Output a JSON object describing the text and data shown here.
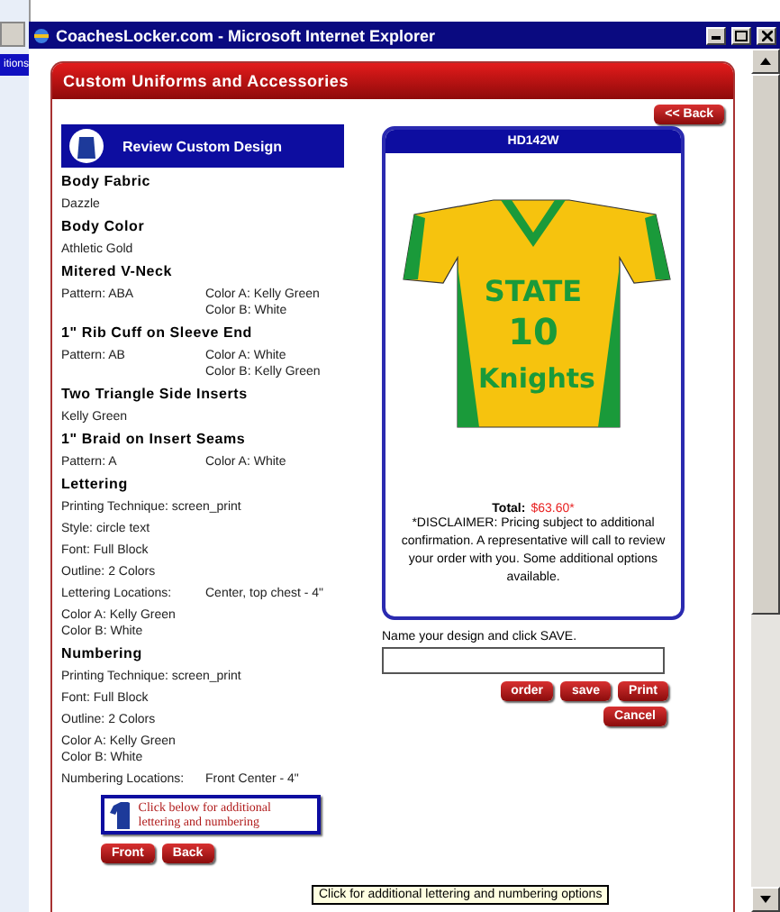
{
  "background": {
    "window_text": "itions"
  },
  "window": {
    "title": "CoachesLocker.com - Microsoft Internet Explorer"
  },
  "panel": {
    "title": "Custom Uniforms and Accessories",
    "back_button": "<< Back"
  },
  "review": {
    "title": "Review Custom Design",
    "sections": [
      {
        "heading": "Body Fabric",
        "lines": [
          {
            "kind": "text",
            "text": "Dazzle"
          }
        ]
      },
      {
        "heading": "Body Color",
        "lines": [
          {
            "kind": "text",
            "text": "Athletic Gold"
          }
        ]
      },
      {
        "heading": "Mitered V-Neck",
        "lines": [
          {
            "kind": "pair",
            "text": "Pattern: ABA",
            "values": [
              "Color A: Kelly Green",
              "Color B: White"
            ]
          }
        ]
      },
      {
        "heading": "1\" Rib Cuff on Sleeve End",
        "lines": [
          {
            "kind": "pair",
            "text": "Pattern: AB",
            "values": [
              "Color A: White",
              "Color B: Kelly Green"
            ]
          }
        ]
      },
      {
        "heading": "Two Triangle Side Inserts",
        "lines": [
          {
            "kind": "text",
            "text": "Kelly Green"
          }
        ]
      },
      {
        "heading": "1\" Braid on Insert Seams",
        "lines": [
          {
            "kind": "pair",
            "text": "Pattern: A",
            "values": [
              "Color A: White"
            ]
          }
        ]
      },
      {
        "heading": "Lettering",
        "lines": [
          {
            "kind": "text",
            "text": "Printing Technique: screen_print"
          },
          {
            "kind": "text",
            "text": "Style: circle text"
          },
          {
            "kind": "text",
            "text": "Font: Full Block"
          },
          {
            "kind": "text",
            "text": "Outline: 2 Colors"
          },
          {
            "kind": "pair",
            "text": "Lettering Locations:",
            "values": [
              "Center, top chest - 4\""
            ]
          },
          {
            "kind": "stack",
            "values": [
              "Color A: Kelly Green",
              "Color B: White"
            ]
          }
        ]
      },
      {
        "heading": "Numbering",
        "lines": [
          {
            "kind": "text",
            "text": "Printing Technique: screen_print"
          },
          {
            "kind": "text",
            "text": "Font: Full Block"
          },
          {
            "kind": "text",
            "text": "Outline: 2 Colors"
          },
          {
            "kind": "stack",
            "values": [
              "Color A: Kelly Green",
              "Color B: White"
            ]
          },
          {
            "kind": "pair",
            "text": "Numbering Locations:",
            "values": [
              "Front Center - 4\""
            ]
          }
        ]
      }
    ]
  },
  "promo": {
    "text": "Click below for additional lettering and numbering"
  },
  "view_buttons": [
    "Front",
    "Back"
  ],
  "product": {
    "code": "HD142W",
    "jersey_text": [
      "STATE",
      "10",
      "Knights"
    ],
    "total_label": "Total:",
    "total": "$63.60*",
    "disclaimer": "*DISCLAIMER: Pricing subject to additional confirmation. A representative will call to review your order with you. Some additional options available."
  },
  "save_form": {
    "label": "Name your design and click SAVE."
  },
  "actions": [
    "order",
    "save",
    "Print"
  ],
  "cancel": "Cancel",
  "tooltip": "Click for additional lettering and numbering options"
}
